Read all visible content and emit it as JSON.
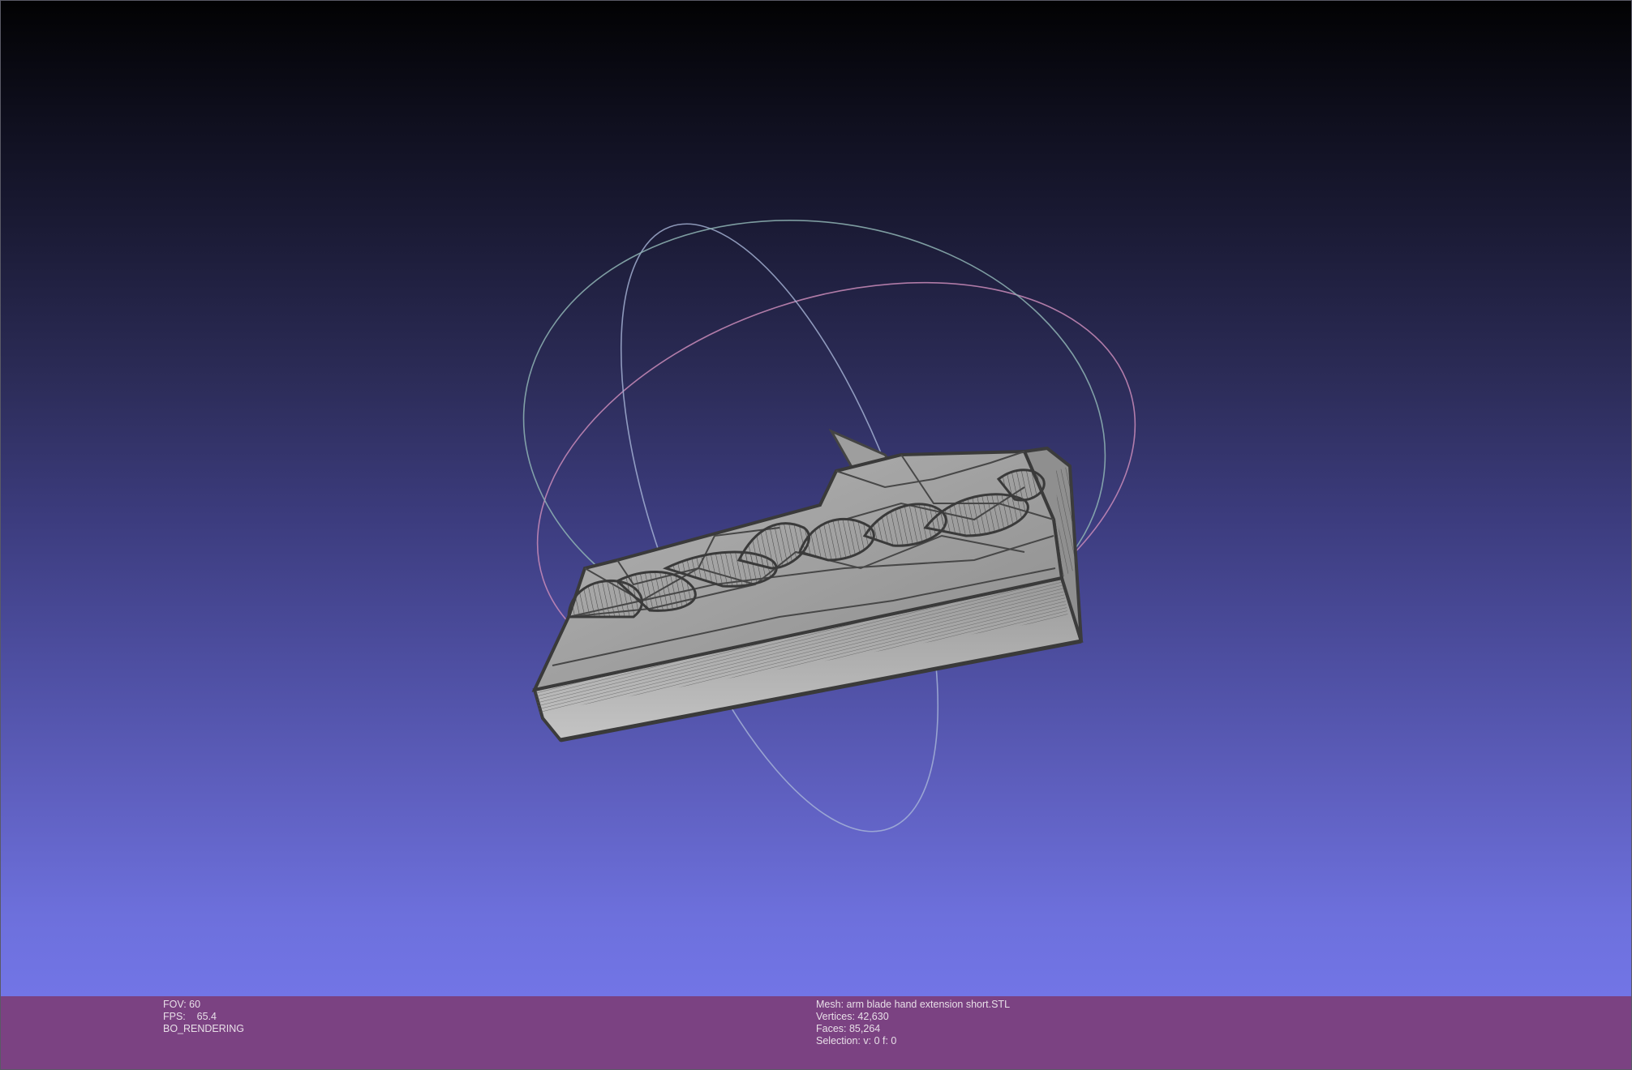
{
  "viewport": {
    "background_top": "#020203",
    "background_bottom": "#7275e6",
    "model_color": "#a8a8a8",
    "edge_color": "#3e3e3e"
  },
  "info_left": {
    "fov": "FOV: 60",
    "fps": "FPS:    65.4",
    "render_mode": "BO_RENDERING"
  },
  "info_right": {
    "mesh": "Mesh: arm blade hand extension short.STL",
    "vertices": "Vertices: 42,630",
    "faces": "Faces: 85,264",
    "selection": "Selection: v: 0 f: 0"
  },
  "info_bar": {
    "color": "#7b4282"
  },
  "trackball": {
    "present": true
  }
}
